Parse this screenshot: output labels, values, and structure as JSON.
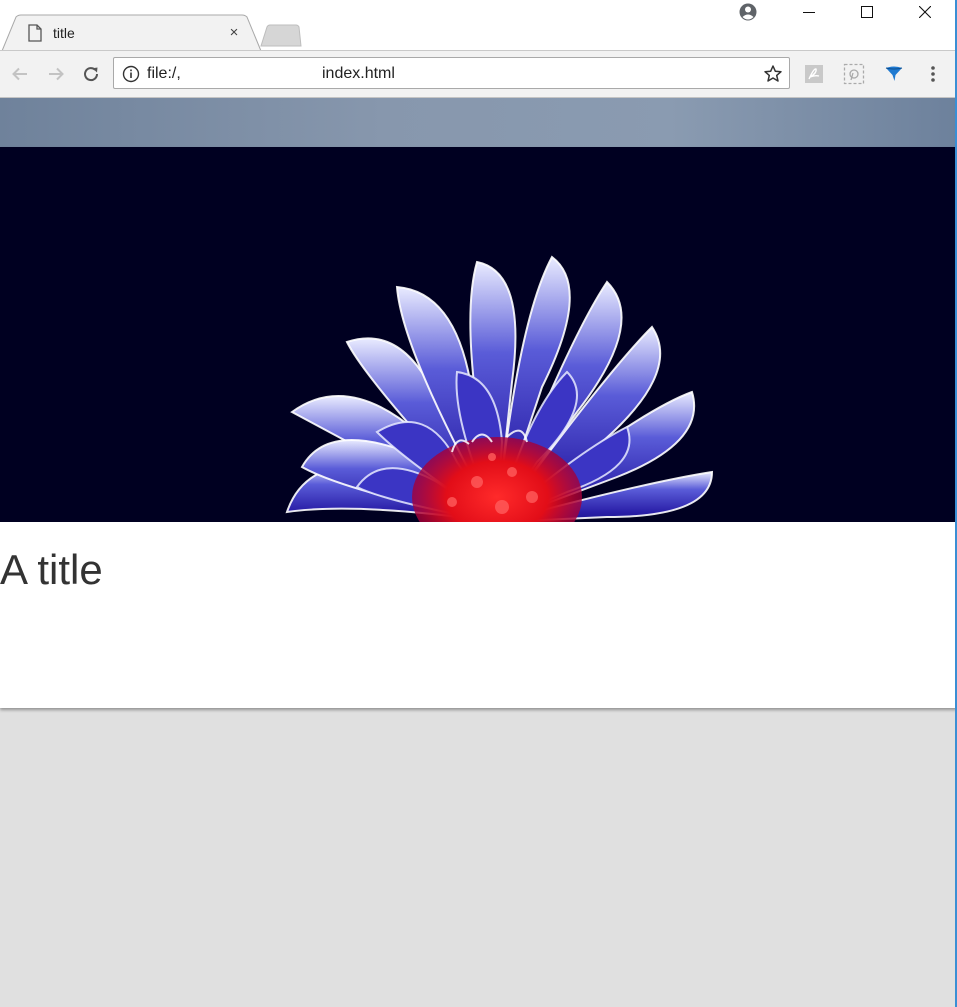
{
  "browser": {
    "tab": {
      "title": "title",
      "close_glyph": "×"
    },
    "address": {
      "prefix": "file:/,",
      "file": "index.html"
    },
    "icons": {
      "tab_favicon": "document-icon",
      "new_tab": "new-tab-icon",
      "profile": "account-circle-icon",
      "minimize": "minimize-icon",
      "maximize": "maximize-icon",
      "close": "close-icon",
      "back": "arrow-left-icon",
      "forward": "arrow-right-icon",
      "reload": "reload-icon",
      "info": "info-icon",
      "bookmark": "star-icon",
      "extensions": [
        "acrobat-icon",
        "clipper-icon",
        "funnel-icon"
      ],
      "menu": "more-vert-icon"
    }
  },
  "page": {
    "title": "A title",
    "hero_image": "blue-red-dahlia-flower",
    "colors": {
      "header_band": "#7f92aa",
      "hero_background": "#000021",
      "page_background": "#e0e0e0"
    }
  }
}
